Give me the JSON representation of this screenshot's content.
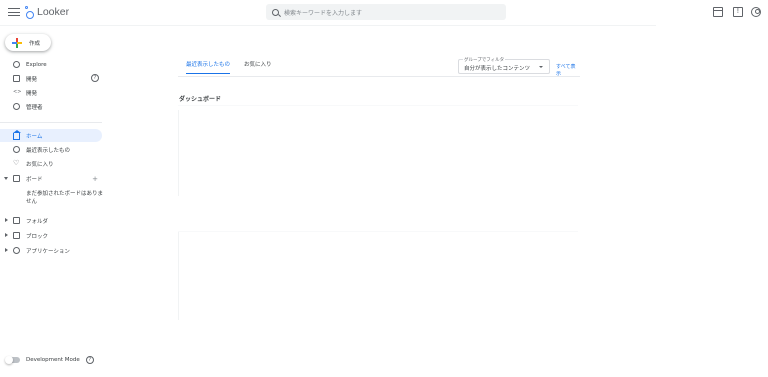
{
  "header": {
    "app_name": "Looker",
    "search_placeholder": "検索キーワードを入力します",
    "icons": [
      "menu-icon",
      "marketplace-icon",
      "help-icon",
      "account-icon"
    ]
  },
  "sidebar": {
    "create_label": "作成",
    "primary_items": [
      {
        "label": "Explore",
        "icon": "explore-icon"
      },
      {
        "label": "開発",
        "icon": "develop-icon"
      },
      {
        "label": "開発",
        "icon": "code-icon"
      },
      {
        "label": "管理者",
        "icon": "admin-icon"
      }
    ],
    "secondary_items": [
      {
        "label": "ホーム",
        "icon": "home-icon",
        "active": true
      },
      {
        "label": "最近表示したもの",
        "icon": "clock-icon"
      },
      {
        "label": "お気に入り",
        "icon": "heart-icon"
      },
      {
        "label": "ボード",
        "icon": "board-icon"
      }
    ],
    "board_subitem": "まだ参加されたボードはありません",
    "folder_items": [
      {
        "label": "フォルダ",
        "icon": "folder-icon"
      },
      {
        "label": "ブロック",
        "icon": "blocks-icon"
      },
      {
        "label": "アプリケーション",
        "icon": "apps-icon"
      }
    ],
    "dev_mode_label": "Development Mode"
  },
  "main": {
    "tabs": [
      {
        "label": "最近表示したもの",
        "active": true
      },
      {
        "label": "お気に入り",
        "active": false
      }
    ],
    "group_filter_label": "グループでフィルタ",
    "group_filter_value": "自分が表示したコンテンツ",
    "show_all": "すべて表示",
    "section_title": "ダッシュボード"
  },
  "colors": {
    "accent": "#1a73e8",
    "active_bg": "#e8f0fe",
    "text": "#3c4043"
  }
}
